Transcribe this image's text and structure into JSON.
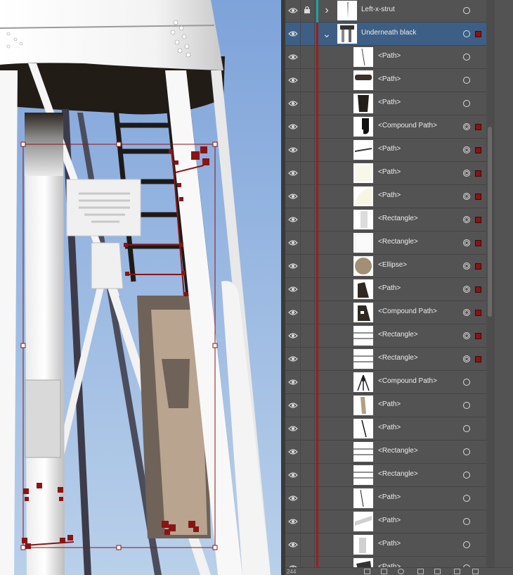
{
  "colors": {
    "sky_top": "#7da2d9",
    "sky_bottom": "#bcd2e8",
    "selection_red": "#8a1414",
    "panel_bg": "#535353",
    "row_selected": "#3d5f86",
    "layer_color_teal": "#1aa3a3",
    "layer_color_red": "#a11c1c"
  },
  "layers_panel": {
    "layer_count": "244",
    "rows": [
      {
        "name": "Left-x-strut",
        "type": "layer",
        "locked": true,
        "expanded": false,
        "target": "empty",
        "selected": false,
        "thumb_icon": "strut-thumbnail-icon"
      },
      {
        "name": "Underneath black",
        "type": "layer",
        "locked": false,
        "expanded": true,
        "target": "empty",
        "selected": true,
        "thumb_icon": "tower-thumbnail-icon"
      },
      {
        "name": "<Path>",
        "target": "empty",
        "selected": false,
        "thumb_icon": "thin-line-thumbnail-icon"
      },
      {
        "name": "<Path>",
        "target": "empty",
        "selected": false,
        "thumb_icon": "dark-band-thumbnail-icon"
      },
      {
        "name": "<Path>",
        "target": "empty",
        "selected": false,
        "thumb_icon": "dark-shape-thumbnail-icon"
      },
      {
        "name": "<Compound Path>",
        "target": "applied",
        "selected": true,
        "thumb_icon": "black-hook-thumbnail-icon"
      },
      {
        "name": "<Path>",
        "target": "applied",
        "selected": true,
        "thumb_icon": "diagonal-line-thumbnail-icon"
      },
      {
        "name": "<Path>",
        "target": "applied",
        "selected": true,
        "thumb_icon": "pale-fill-thumbnail-icon"
      },
      {
        "name": "<Path>",
        "target": "applied",
        "selected": true,
        "thumb_icon": "pale-curve-thumbnail-icon"
      },
      {
        "name": "<Rectangle>",
        "target": "applied",
        "selected": true,
        "thumb_icon": "grey-rect-thumbnail-icon"
      },
      {
        "name": "<Rectangle>",
        "target": "applied",
        "selected": true,
        "thumb_icon": "white-rect-thumbnail-icon"
      },
      {
        "name": "<Ellipse>",
        "target": "applied",
        "selected": true,
        "thumb_icon": "tan-ellipse-thumbnail-icon"
      },
      {
        "name": "<Path>",
        "target": "applied",
        "selected": true,
        "thumb_icon": "dark-bracket-thumbnail-icon"
      },
      {
        "name": "<Compound Path>",
        "target": "applied",
        "selected": true,
        "thumb_icon": "dark-bracket-cutout-thumbnail-icon"
      },
      {
        "name": "<Rectangle>",
        "target": "applied",
        "selected": true,
        "thumb_icon": "two-lines-thumbnail-icon"
      },
      {
        "name": "<Rectangle>",
        "target": "applied",
        "selected": true,
        "thumb_icon": "two-lines-thumbnail-icon"
      },
      {
        "name": "<Compound Path>",
        "target": "empty",
        "selected": false,
        "thumb_icon": "tripod-thumbnail-icon"
      },
      {
        "name": "<Path>",
        "target": "empty",
        "selected": false,
        "thumb_icon": "tan-bar-thumbnail-icon"
      },
      {
        "name": "<Path>",
        "target": "empty",
        "selected": false,
        "thumb_icon": "black-line-thumbnail-icon"
      },
      {
        "name": "<Rectangle>",
        "target": "empty",
        "selected": false,
        "thumb_icon": "two-lines-thumbnail-icon"
      },
      {
        "name": "<Rectangle>",
        "target": "empty",
        "selected": false,
        "thumb_icon": "two-lines-thumbnail-icon"
      },
      {
        "name": "<Path>",
        "target": "empty",
        "selected": false,
        "thumb_icon": "thin-dark-line-thumbnail-icon"
      },
      {
        "name": "<Path>",
        "target": "empty",
        "selected": false,
        "thumb_icon": "grey-diagonal-thumbnail-icon"
      },
      {
        "name": "<Path>",
        "target": "empty",
        "selected": false,
        "thumb_icon": "grey-bracket-thumbnail-icon"
      },
      {
        "name": "<Path>",
        "target": "empty",
        "selected": false,
        "thumb_icon": "dark-blob-thumbnail-icon"
      }
    ]
  }
}
